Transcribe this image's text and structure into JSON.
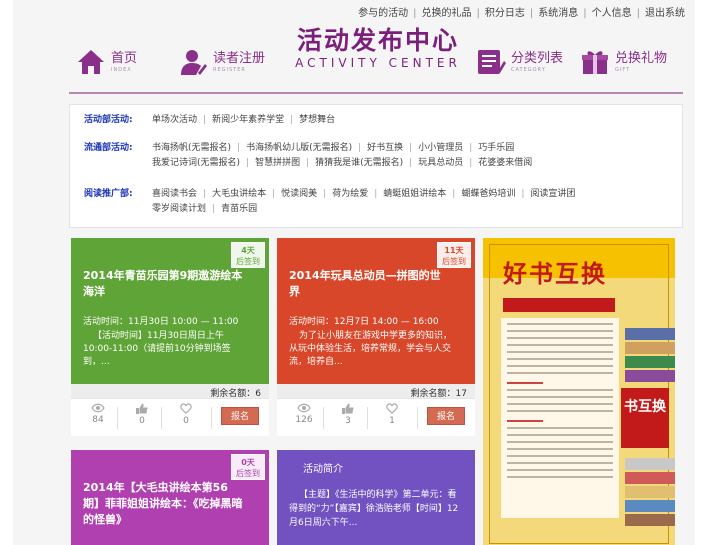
{
  "top_links": [
    "参与的活动",
    "兑换的礼品",
    "积分日志",
    "系统消息",
    "个人信息",
    "退出系统"
  ],
  "nav": {
    "home": {
      "cn": "首页",
      "en": "INDEX"
    },
    "register": {
      "cn": "读者注册",
      "en": "REGISTER"
    },
    "category": {
      "cn": "分类列表",
      "en": "CATEGORY"
    },
    "gift": {
      "cn": "兑换礼物",
      "en": "GIFT"
    }
  },
  "logo": {
    "cn": "活动发布中心",
    "en": "ACTIVITY CENTER"
  },
  "categories": [
    {
      "head": "活动部活动:",
      "items": [
        "单场次活动",
        "新阅少年素养学堂",
        "梦想舞台"
      ]
    },
    {
      "head": "流通部活动:",
      "items": [
        "书海扬帆(无需报名)",
        "书海扬帆幼儿版(无需报名)",
        "好书互换",
        "小小管理员",
        "巧手乐园",
        "我爱记诗词(无需报名)",
        "智慧拼拼图",
        "猜猜我是谁(无需报名)",
        "玩具总动员",
        "花婆婆来借阅"
      ]
    },
    {
      "head": "阅读推广部:",
      "items": [
        "喜阅读书会",
        "大毛虫讲绘本",
        "悦读阅美",
        "荷为绘爱",
        "蜻蜓姐姐讲绘本",
        "蝴蝶爸妈培训",
        "阅读宣讲团",
        "零岁阅读计划",
        "青苗乐园"
      ]
    }
  ],
  "cards": [
    {
      "badge_days": "4天",
      "badge_text": "后签到",
      "title": "2014年青苗乐园第9期遨游绘本海洋",
      "time": "活动时间：11月30日 10:00 — 11:00",
      "desc": "【活动时间】11月30日周日上午10:00-11:00（请提前10分钟到场签到，...",
      "remain": "剩余名额：6",
      "views": "84",
      "likes": "0",
      "favs": "0",
      "signup": "报名"
    },
    {
      "badge_days": "11天",
      "badge_text": "后签到",
      "title": "2014年玩具总动员—拼图的世界",
      "time": "活动时间：12月7日 14:00 — 16:00",
      "desc": "为了让小朋友在游戏中学更多的知识，从玩中体验生活，培养常规，学会与人交流，培养自...",
      "remain": "剩余名额：17",
      "views": "126",
      "likes": "3",
      "favs": "1",
      "signup": "报名"
    },
    {
      "badge_days": "0天",
      "badge_text": "后签到",
      "title": "2014年【大毛虫讲绘本第56期】菲菲姐姐讲绘本：《吃掉黑暗的怪兽》"
    },
    {
      "section_title": "活动简介",
      "desc": "【主题】《生活中的科学》第二单元：看得到的“力”【嘉宾】徐浩贻老师【时间】12月6日周六下午..."
    }
  ],
  "poster": {
    "headline": "好书互换",
    "hang_text": "书互换"
  },
  "colors": {
    "green": "#5fa436",
    "red": "#d8472a",
    "magenta": "#b040b0",
    "violet": "#7152c0",
    "brand": "#7b1f7b",
    "link_blue": "#1c35b8"
  }
}
